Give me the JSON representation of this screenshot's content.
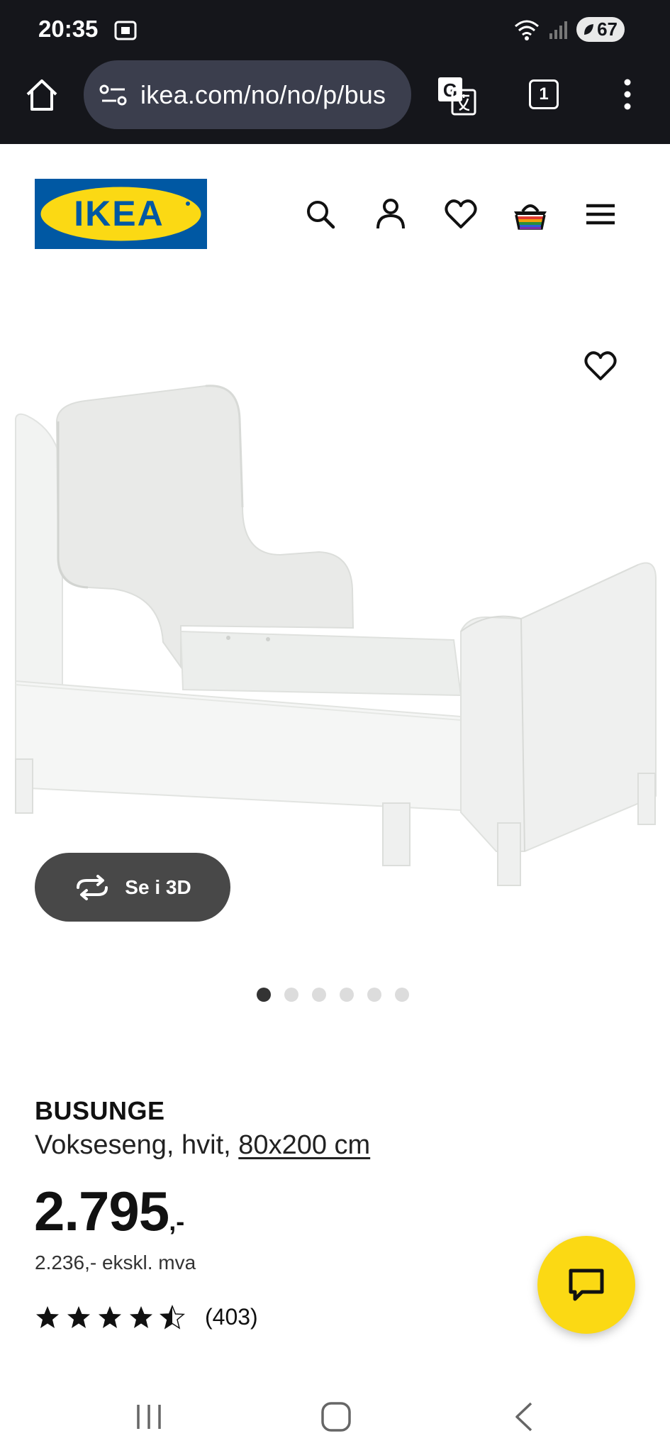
{
  "status_bar": {
    "time": "20:35",
    "battery": "67"
  },
  "browser": {
    "url": "ikea.com/no/no/p/bus",
    "tab_count": "1"
  },
  "header": {
    "logo_text": "IKEA",
    "brand_colors": {
      "blue": "#0058a3",
      "yellow": "#fbd914"
    },
    "icons": [
      "search-icon",
      "account-icon",
      "heart-icon",
      "basket-icon",
      "menu-icon"
    ]
  },
  "gallery": {
    "view_3d_label": "Se i 3D",
    "dot_count": 6,
    "active_dot": 0
  },
  "product": {
    "name": "BUSUNGE",
    "description": "Vokseseng, hvit,",
    "size_link": "80x200 cm",
    "price_main": "2.795",
    "price_suffix": ",-",
    "price_ex_vat": "2.236,- ekskl. mva",
    "rating_value": 4.5,
    "rating_max": 5,
    "review_count": "(403)"
  },
  "chat": {
    "icon": "chat-icon",
    "color": "#fbd914"
  }
}
